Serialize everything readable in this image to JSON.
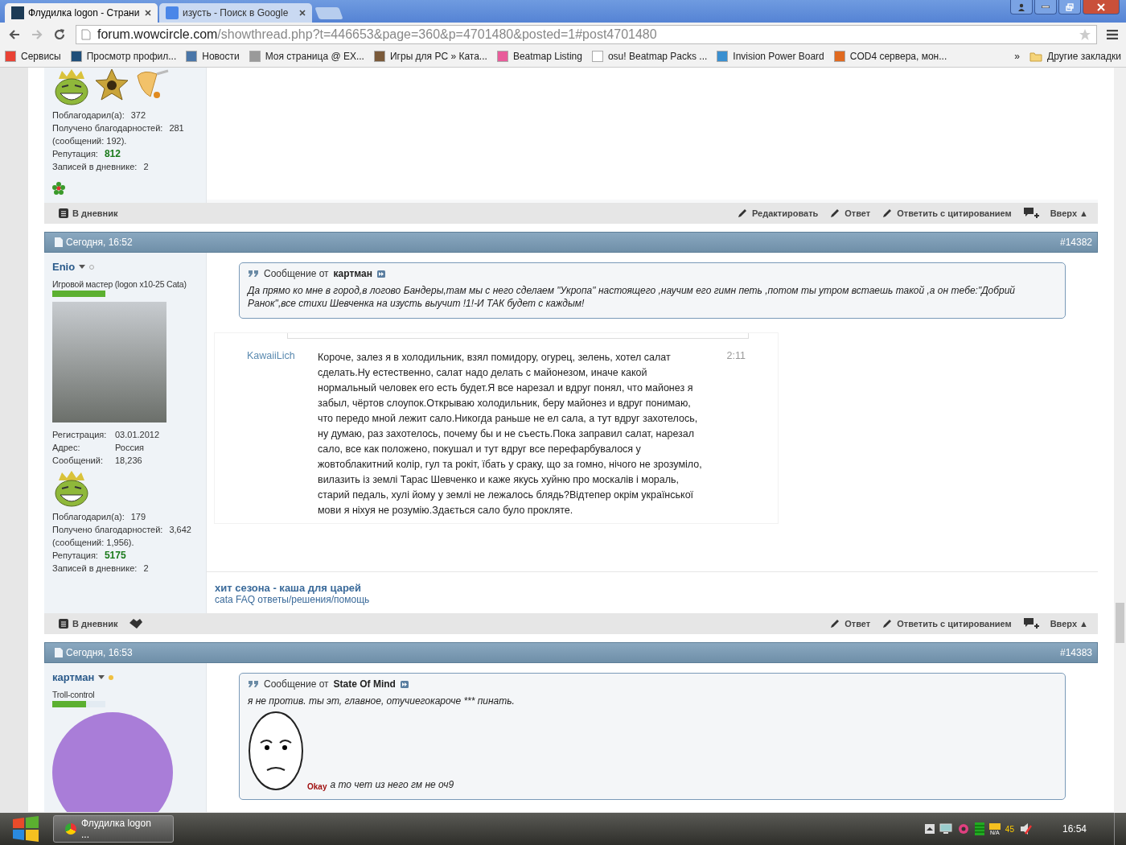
{
  "browser": {
    "tabs": [
      {
        "title": "Флудилка logon - Страни",
        "selected": true
      },
      {
        "title": "изусть - Поиск в Google",
        "selected": false
      }
    ],
    "address": {
      "host": "forum.wowcircle.com",
      "path": "/showthread.php?t=446653&page=360&p=4701480&posted=1#post4701480"
    },
    "bookmarks": [
      "Сервисы",
      "Просмотр профил...",
      "Новости",
      "Моя страница @ EX...",
      "Игры для PC » Ката...",
      "Beatmap Listing",
      "osu! Beatmap Packs ...",
      "Invision Power Board",
      "COD4 сервера, мон..."
    ],
    "bookmarks_overflow": "»",
    "other_bookmarks": "Другие закладки"
  },
  "posts": [
    {
      "badges": [
        {
          "kind": "troll"
        },
        {
          "kind": "star"
        },
        {
          "kind": "scroll"
        }
      ],
      "stats": [
        {
          "label": "Поблагодарил(а):",
          "value": "372",
          "kind": "plain"
        },
        {
          "label": "Получено благодарностей:",
          "value": "281",
          "kind": "plain"
        },
        {
          "label": "(сообщений: 192).",
          "kind": "note"
        },
        {
          "label": "Репутация:",
          "value": "812",
          "kind": "reputation"
        },
        {
          "label": "Записей в дневнике:",
          "value": "2",
          "kind": "plain"
        }
      ],
      "contact_icons": [
        {
          "kind": "icq"
        }
      ],
      "footer": {
        "left": [
          {
            "kind": "diary",
            "label": "В дневник"
          }
        ],
        "right": [
          "Редактировать",
          "Ответ",
          "Ответить с цитированием"
        ],
        "top": "Вверх ▲"
      }
    },
    {
      "date": "Сегодня, 16:52",
      "number": "#14382",
      "user": "Enio",
      "online": false,
      "user_title": "Игровой мастер (logon x10-25 Cata)",
      "reputation_bar": {
        "level": 1
      },
      "avatar": {
        "kind": "photo"
      },
      "details": [
        {
          "label": "Регистрация:",
          "value": "03.01.2012"
        },
        {
          "label": "Адрес:",
          "value": "Россия"
        },
        {
          "label": "Сообщений:",
          "value": "18,236"
        }
      ],
      "badges": [
        {
          "kind": "troll"
        }
      ],
      "stats": [
        {
          "label": "Поблагодарил(а):",
          "value": "179",
          "kind": "plain"
        },
        {
          "label": "Получено благодарностей:",
          "value": "3,642",
          "kind": "plain"
        },
        {
          "label": "(сообщений: 1,956).",
          "kind": "note"
        },
        {
          "label": "Репутация:",
          "value": "5175",
          "kind": "reputation"
        },
        {
          "label": "Записей в дневнике:",
          "value": "2",
          "kind": "plain"
        }
      ],
      "quote": {
        "prefix": "Сообщение от",
        "author": "картман",
        "text": "Да прямо ко мне в город,в логово Бандеры,там мы с него сделаем \"Укропа\" настоящего ,научим его гимн петь ,потом ты утром встаешь такой ,а он тебе:\"Добрий Ранок\",все стихи Шевченка на изусть выучит !1!-И ТАК будет с каждым!"
      },
      "chat": {
        "name": "KawaiiLich",
        "time": "2:11",
        "text": "Короче, залез я в холодильник, взял помидору, огурец, зелень, хотел салат сделать.Ну естественно, салат надо делать с майонезом, иначе какой нормальный человек его есть будет.Я все нарезал и вдруг понял, что майонез я забыл, чёртов слоупок.Открываю холодильник, беру майонез и вдруг понимаю, что передо мной лежит сало.Никогда раньше не ел сала, а тут вдруг захотелось, ну думаю, раз захотелось, почему бы и не съесть.Пока заправил салат, нарезал сало, все как положено, покушал и тут вдруг все перефарбувалося у жовтоблакитний колір, гул та рокіт, їбать у сраку, що за гомно, нічого не зрозуміло, вилазить із землі Тарас Шевченко и каже якусь хуйню про москалів і мораль, старий педаль, хулі йому у землі не лежалось блядь?Відтепер окрім української мови я ніхуя не розумію.Здається сало було прокляте."
      },
      "signature": {
        "title": "хит сезона - каша для царей",
        "link": "cata FAQ ответы/решения/помощь"
      },
      "footer": {
        "left": [
          {
            "kind": "diary",
            "label": "В дневник"
          },
          {
            "kind": "thanks"
          }
        ],
        "right": [
          "Ответ",
          "Ответить с цитированием"
        ],
        "top": "Вверх ▲"
      }
    },
    {
      "date": "Сегодня, 16:53",
      "number": "#14383",
      "user": "картман",
      "online": true,
      "user_title": "Troll-control",
      "reputation_bar": {
        "level": 0.64
      },
      "avatar": {
        "kind": "circle"
      },
      "quote": {
        "prefix": "Сообщение от",
        "author": "State Of Mind",
        "text": "я не против. ты эт, главное, отучиегокароче *** пинать.",
        "caption": "Okay",
        "after": "а то чет из него гм не оч9"
      }
    }
  ],
  "taskbar": {
    "window": "Флудилка logon ...",
    "tray_label": "N/A",
    "tray_number": "45",
    "clock": "16:54"
  }
}
